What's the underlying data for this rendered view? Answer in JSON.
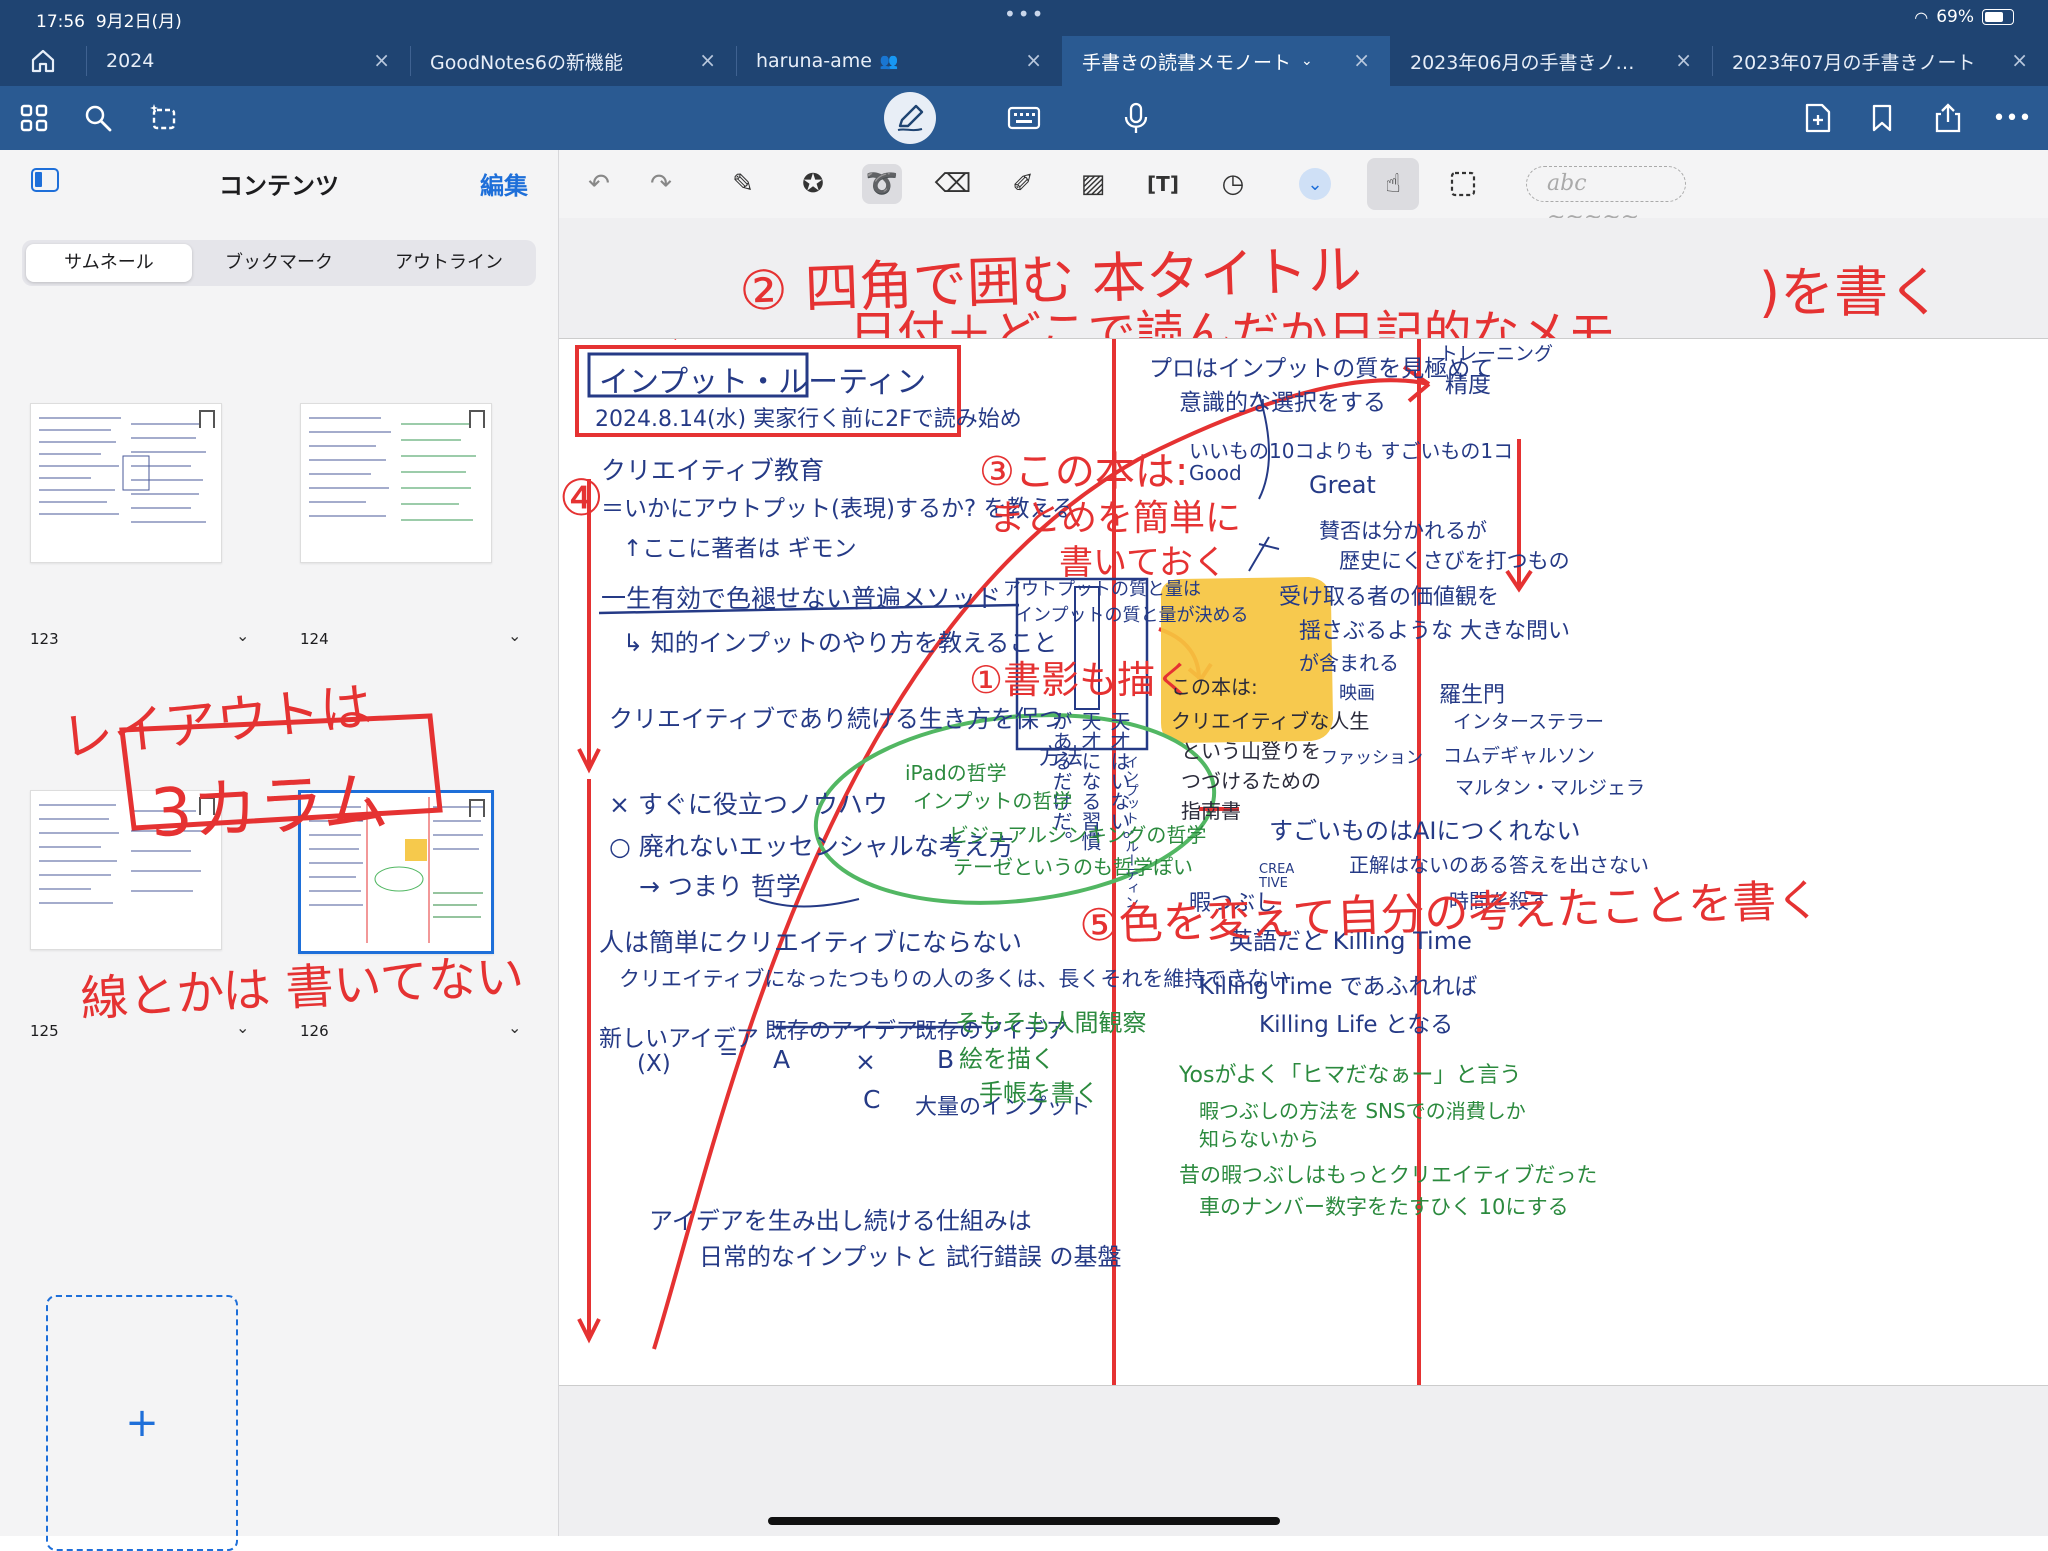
{
  "status": {
    "time": "17:56",
    "date": "9月2日(月)",
    "battery": "69%"
  },
  "tabs": [
    {
      "label": "2024"
    },
    {
      "label": "GoodNotes6の新機能"
    },
    {
      "label": "haruna-ame"
    },
    {
      "label": "手書きの読書メモノート"
    },
    {
      "label": "2023年06月の手書きノ…"
    },
    {
      "label": "2023年07月の手書きノート"
    }
  ],
  "sidebar": {
    "title": "コンテンツ",
    "edit": "編集",
    "segments": [
      "サムネール",
      "ブックマーク",
      "アウトライン"
    ],
    "pages": [
      "123",
      "124",
      "125",
      "126"
    ],
    "add": "+"
  },
  "toolbar": {
    "abc_placeholder": "abc ~~~~~"
  },
  "note": {
    "top1": "② 四角で囲む 本タイトル",
    "top2": "日付＋どこで読んだか日記的なメモ",
    "top3": ")を書く",
    "left_overlay1": "レイアウトは",
    "left_overlay2": "3カラム",
    "left_overlay3": "線とかは 書いてない",
    "booktitle": "インプット・ルーティン",
    "date_line": "2024.8.14(水) 実家行く前に2Fで読み始め",
    "c1": [
      "クリエイティブ教育",
      "＝いかにアウトプット(表現)するか? を教える",
      "↑ここに著者は ギモン",
      "一生有効で色褪せない普遍メソッド",
      "↳ 知的インプットのやり方を教えること",
      "クリエイティブであり続ける生き方を保つ",
      "方法",
      "× すぐに役立つノウハウ",
      "○ 廃れないエッセンシャルな考え方",
      "→ つまり 哲学",
      "人は簡単にクリエイティブにならない",
      "クリエイティブになったつもりの人の多くは、長くそれを維持できない",
      "新しいアイデア",
      "(X)",
      "=",
      "既存のアイデア",
      "A",
      "×",
      "既存のアイデア",
      "B",
      "C",
      "大量のインプット",
      "アイデアを生み出し続ける仕組みは",
      "日常的なインプットと 試行錯誤 の基盤"
    ],
    "num3": "③この本は:",
    "num3b": "まとめを簡単に",
    "num3c": "書いておく",
    "c2_1": "アウトプットの質と量は",
    "c2_2": "インプットの質と量が決める",
    "num1": "①書影も描く",
    "cover_text": "天才はいない。天才になる習慣があるだけだ。",
    "cover_author": "インプット・ルーティン",
    "yellow": [
      "この本は:",
      "クリエイティブな人生",
      "という山登りを",
      "つづけるための",
      "指南書"
    ],
    "crea": "CREA TIVE",
    "green": [
      "iPadの哲学",
      "インプットの哲学",
      "ビジュアルシンキングの哲学",
      "テーゼというのも哲学ぽい"
    ],
    "green2": [
      "そもそも人間観察",
      "絵を描く",
      "手帳を書く"
    ],
    "num4": "④",
    "num5": "⑤色を変えて自分の考えたことを書く",
    "c3": [
      "プロはインプットの質を見極めて",
      "意識的な選択をする",
      "トレーニング",
      "精度",
      "いいもの10コよりも すごいもの1コ",
      "Good",
      "Great",
      "賛否は分かれるが",
      "歴史にくさびを打つもの",
      "受け取る者の価値観を",
      "揺さぶるような 大きな問い",
      "が含まれる",
      "映画",
      "羅生門",
      "インターステラー",
      "ファッション",
      "コムデギャルソン",
      "マルタン・マルジェラ",
      "すごいものはAIにつくれない",
      "正解はないのある答えを出さない",
      "暇つぶし",
      "時間を殺す",
      "英語だと Killing Time",
      "Killing Time であふれれば",
      "Killing Life となる",
      "Yosがよく「ヒマだなぁー」と言う",
      "暇つぶしの方法を SNSでの消費しか",
      "知らないから",
      "昔の暇つぶしはもっとクリエイティブだった",
      "車のナンバー数字をたすひく 10にする"
    ]
  }
}
